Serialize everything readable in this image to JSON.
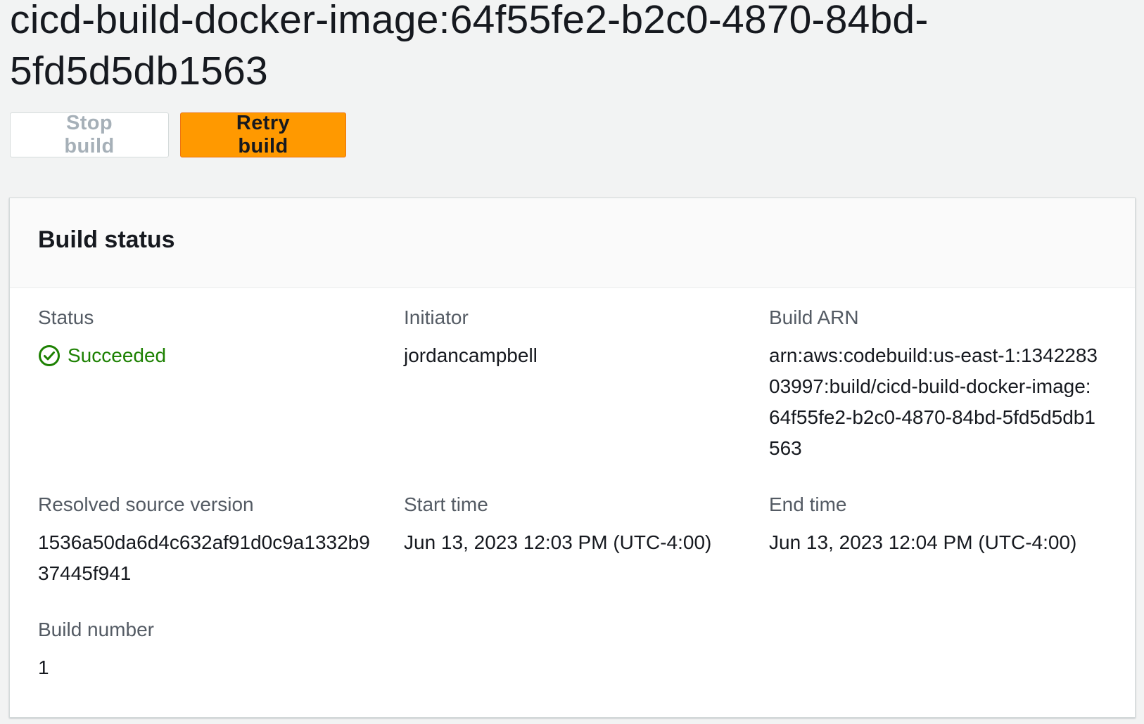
{
  "page": {
    "title": "cicd-build-docker-image:64f55fe2-b2c0-4870-84bd-5fd5d5db1563"
  },
  "actions": {
    "stop_label": "Stop build",
    "retry_label": "Retry build"
  },
  "panel": {
    "title": "Build status",
    "status": {
      "label": "Status",
      "value": "Succeeded",
      "icon": "check-circle-icon",
      "color": "#1d8102"
    },
    "initiator": {
      "label": "Initiator",
      "value": "jordancampbell"
    },
    "build_arn": {
      "label": "Build ARN",
      "value": "arn:aws:codebuild:us-east-1:134228303997:build/cicd-build-docker-image:64f55fe2-b2c0-4870-84bd-5fd5d5db1563"
    },
    "resolved_source_version": {
      "label": "Resolved source version",
      "value": "1536a50da6d4c632af91d0c9a1332b937445f941"
    },
    "start_time": {
      "label": "Start time",
      "value": "Jun 13, 2023 12:03 PM (UTC-4:00)"
    },
    "end_time": {
      "label": "End time",
      "value": "Jun 13, 2023 12:04 PM (UTC-4:00)"
    },
    "build_number": {
      "label": "Build number",
      "value": "1"
    }
  },
  "colors": {
    "accent": "#ff9900",
    "success": "#1d8102",
    "background": "#f2f3f3"
  }
}
